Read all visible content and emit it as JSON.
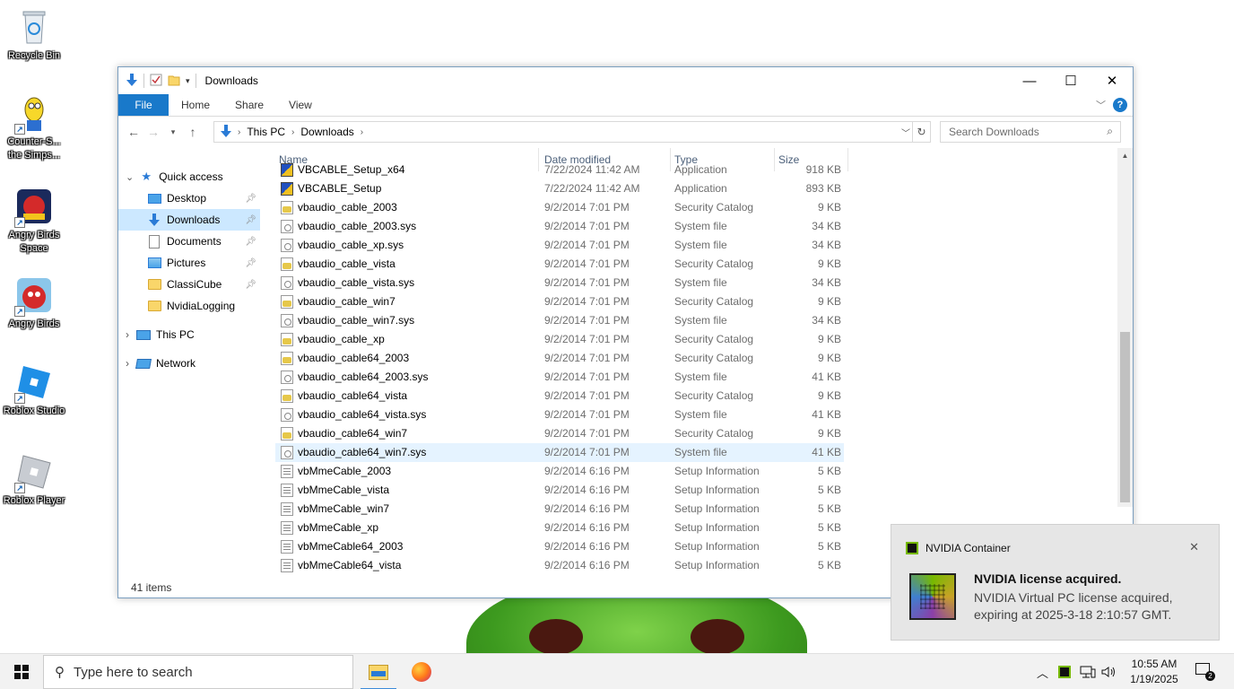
{
  "desktop": {
    "icons": [
      {
        "label": "Recycle Bin"
      },
      {
        "label": "Counter-S... the Simps..."
      },
      {
        "label": "Angry Birds Space"
      },
      {
        "label": "Angry Birds"
      },
      {
        "label": "Roblox Studio"
      },
      {
        "label": "Roblox Player"
      }
    ]
  },
  "window": {
    "title": "Downloads",
    "controls": {
      "minimize": "—",
      "maximize": "☐",
      "close": "✕"
    },
    "ribbon_tabs": [
      "File",
      "Home",
      "Share",
      "View"
    ],
    "address": {
      "segments": [
        "This PC",
        "Downloads"
      ]
    },
    "search_placeholder": "Search Downloads",
    "columns": {
      "name": "Name",
      "date": "Date modified",
      "type": "Type",
      "size": "Size"
    },
    "nav": {
      "quick_access": "Quick access",
      "items": [
        {
          "label": "Desktop",
          "pinned": true
        },
        {
          "label": "Downloads",
          "pinned": true
        },
        {
          "label": "Documents",
          "pinned": true
        },
        {
          "label": "Pictures",
          "pinned": true
        },
        {
          "label": "ClassiCube",
          "pinned": true
        },
        {
          "label": "NvidiaLogging",
          "pinned": false
        }
      ],
      "this_pc": "This PC",
      "network": "Network"
    },
    "files": [
      {
        "name": "VBCABLE_Setup_x64",
        "date": "7/22/2024 11:42 AM",
        "type": "Application",
        "size": "918 KB",
        "icon": "app-icon"
      },
      {
        "name": "VBCABLE_Setup",
        "date": "7/22/2024 11:42 AM",
        "type": "Application",
        "size": "893 KB",
        "icon": "app-icon"
      },
      {
        "name": "vbaudio_cable_2003",
        "date": "9/2/2014 7:01 PM",
        "type": "Security Catalog",
        "size": "9 KB",
        "icon": "catalog-icon"
      },
      {
        "name": "vbaudio_cable_2003.sys",
        "date": "9/2/2014 7:01 PM",
        "type": "System file",
        "size": "34 KB",
        "icon": "system-file-icon"
      },
      {
        "name": "vbaudio_cable_xp.sys",
        "date": "9/2/2014 7:01 PM",
        "type": "System file",
        "size": "34 KB",
        "icon": "system-file-icon"
      },
      {
        "name": "vbaudio_cable_vista",
        "date": "9/2/2014 7:01 PM",
        "type": "Security Catalog",
        "size": "9 KB",
        "icon": "catalog-icon"
      },
      {
        "name": "vbaudio_cable_vista.sys",
        "date": "9/2/2014 7:01 PM",
        "type": "System file",
        "size": "34 KB",
        "icon": "system-file-icon"
      },
      {
        "name": "vbaudio_cable_win7",
        "date": "9/2/2014 7:01 PM",
        "type": "Security Catalog",
        "size": "9 KB",
        "icon": "catalog-icon"
      },
      {
        "name": "vbaudio_cable_win7.sys",
        "date": "9/2/2014 7:01 PM",
        "type": "System file",
        "size": "34 KB",
        "icon": "system-file-icon"
      },
      {
        "name": "vbaudio_cable_xp",
        "date": "9/2/2014 7:01 PM",
        "type": "Security Catalog",
        "size": "9 KB",
        "icon": "catalog-icon"
      },
      {
        "name": "vbaudio_cable64_2003",
        "date": "9/2/2014 7:01 PM",
        "type": "Security Catalog",
        "size": "9 KB",
        "icon": "catalog-icon"
      },
      {
        "name": "vbaudio_cable64_2003.sys",
        "date": "9/2/2014 7:01 PM",
        "type": "System file",
        "size": "41 KB",
        "icon": "system-file-icon"
      },
      {
        "name": "vbaudio_cable64_vista",
        "date": "9/2/2014 7:01 PM",
        "type": "Security Catalog",
        "size": "9 KB",
        "icon": "catalog-icon"
      },
      {
        "name": "vbaudio_cable64_vista.sys",
        "date": "9/2/2014 7:01 PM",
        "type": "System file",
        "size": "41 KB",
        "icon": "system-file-icon"
      },
      {
        "name": "vbaudio_cable64_win7",
        "date": "9/2/2014 7:01 PM",
        "type": "Security Catalog",
        "size": "9 KB",
        "icon": "catalog-icon"
      },
      {
        "name": "vbaudio_cable64_win7.sys",
        "date": "9/2/2014 7:01 PM",
        "type": "System file",
        "size": "41 KB",
        "icon": "system-file-icon",
        "hovered": true
      },
      {
        "name": "vbMmeCable_2003",
        "date": "9/2/2014 6:16 PM",
        "type": "Setup Information",
        "size": "5 KB",
        "icon": "setup-info-icon"
      },
      {
        "name": "vbMmeCable_vista",
        "date": "9/2/2014 6:16 PM",
        "type": "Setup Information",
        "size": "5 KB",
        "icon": "setup-info-icon"
      },
      {
        "name": "vbMmeCable_win7",
        "date": "9/2/2014 6:16 PM",
        "type": "Setup Information",
        "size": "5 KB",
        "icon": "setup-info-icon"
      },
      {
        "name": "vbMmeCable_xp",
        "date": "9/2/2014 6:16 PM",
        "type": "Setup Information",
        "size": "5 KB",
        "icon": "setup-info-icon"
      },
      {
        "name": "vbMmeCable64_2003",
        "date": "9/2/2014 6:16 PM",
        "type": "Setup Information",
        "size": "5 KB",
        "icon": "setup-info-icon"
      },
      {
        "name": "vbMmeCable64_vista",
        "date": "9/2/2014 6:16 PM",
        "type": "Setup Information",
        "size": "5 KB",
        "icon": "setup-info-icon"
      }
    ],
    "status": "41 items"
  },
  "notification": {
    "app": "NVIDIA Container",
    "title": "NVIDIA license acquired.",
    "body": "NVIDIA Virtual PC license acquired, expiring at 2025-3-18 2:10:57 GMT.",
    "close": "✕"
  },
  "taskbar": {
    "search_placeholder": "Type here to search",
    "time": "10:55 AM",
    "date": "1/19/2025",
    "notification_count": "2"
  },
  "colors": {
    "accent": "#1979ca",
    "selection": "#cce8ff",
    "hover": "#e5f3ff",
    "nvidia_green": "#76b900"
  }
}
